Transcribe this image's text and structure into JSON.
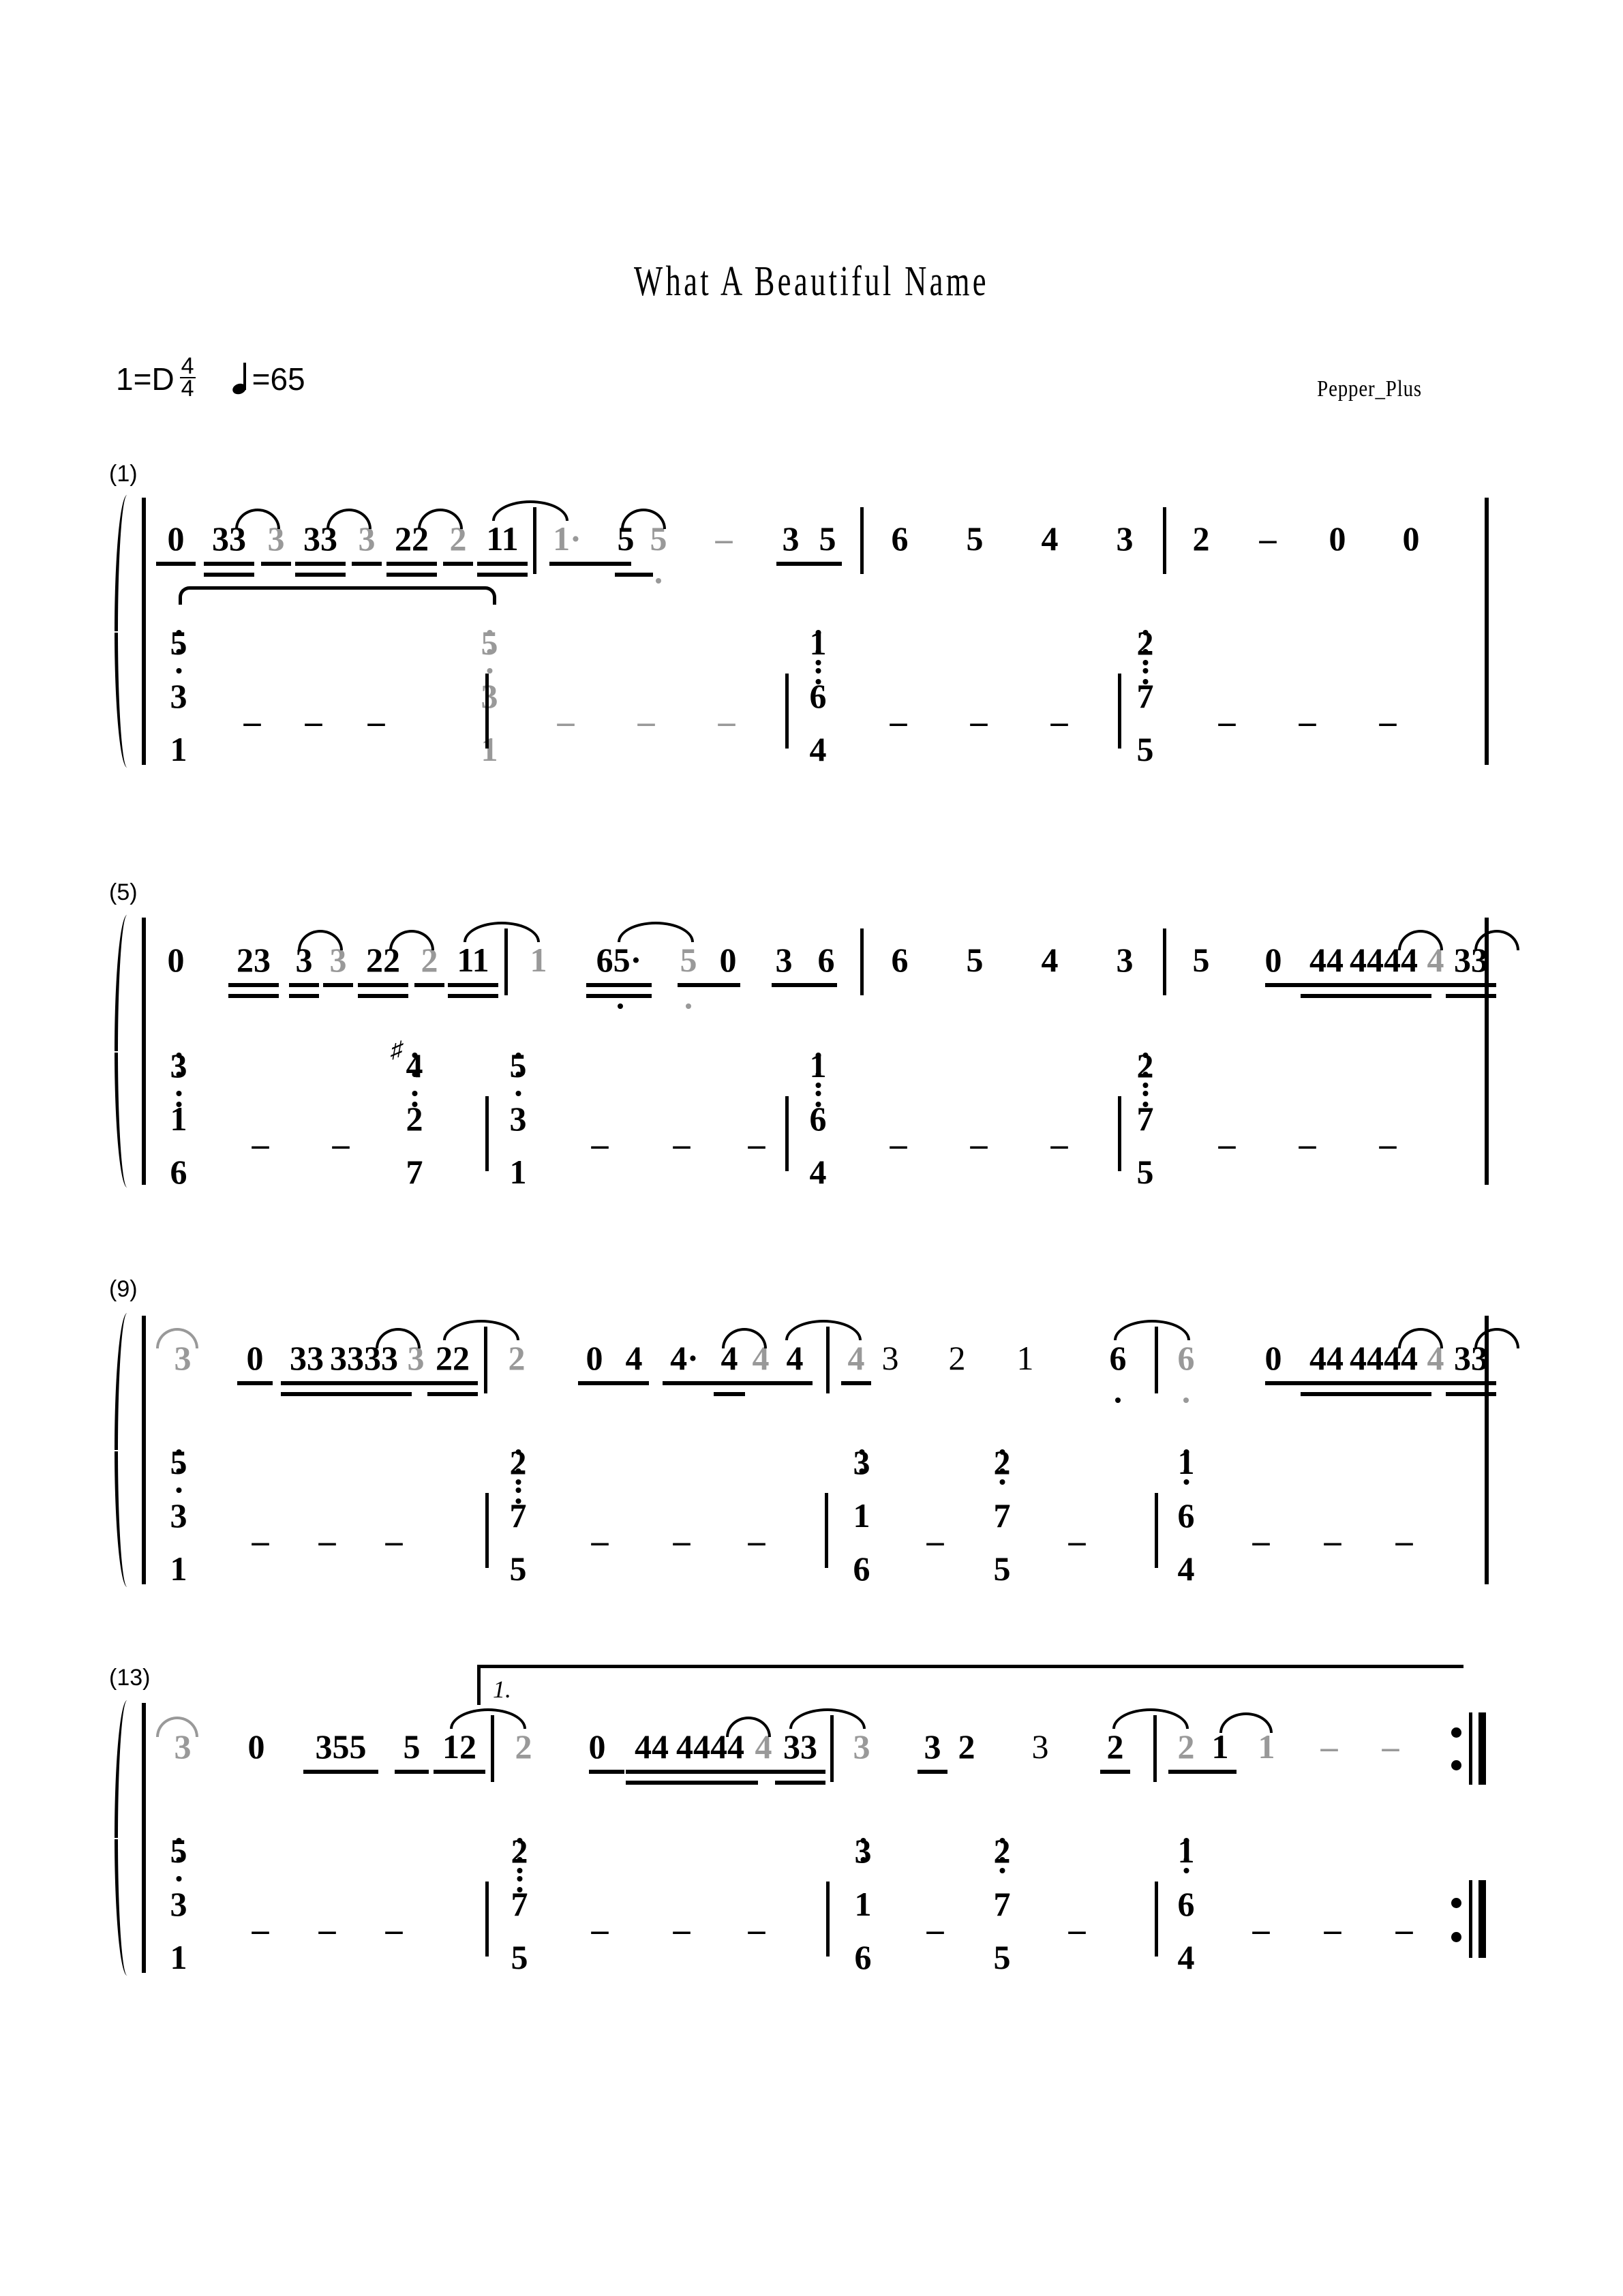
{
  "header": {
    "title": "What A Beautiful Name",
    "key_label": "1=D",
    "time_numerator": "4",
    "time_denominator": "4",
    "tempo_text": "=65",
    "tempo_note_icon": "quarter-note-icon",
    "credit": "Pepper_Plus"
  },
  "score": {
    "notation": "jianpu",
    "staves": [
      "treble",
      "bass"
    ],
    "gray_color": "#999999",
    "ink_color": "#000000",
    "systems": [
      {
        "number": "(1)",
        "treble_text": "0 33 3 33 3 22 2 11 | 1· 5 5 - 3 5 | 6 5 4 3 | 2 - 0 0 |",
        "bass_text": "5/3/1 - - - | 5/3/1 - - - | 1/6/4 - - - | 2/7/5 - - - |",
        "treble_notes": [
          "0",
          "33",
          "3",
          "33",
          "3",
          "22",
          "2",
          "11",
          "1·",
          "5",
          "5",
          "-",
          "3",
          "5",
          "6",
          "5",
          "4",
          "3",
          "2",
          "-",
          "0",
          "0"
        ],
        "bass_chords": [
          [
            "5",
            "3",
            "1"
          ],
          [
            "5",
            "3",
            "1"
          ],
          [
            "1",
            "6",
            "4"
          ],
          [
            "2",
            "7",
            "5"
          ]
        ]
      },
      {
        "number": "(5)",
        "treble_text": "0 23 3 3 22 2 11 | 1 65· 5 0 3 6 | 6 5 4 3 | 5 0 44 4444 4 33 |",
        "bass_text": "3/1/6 - - #4/2/7 | 5/3/1 - - - | 1/6/4 - - - | 2/7/5 - - - |",
        "treble_notes": [
          "0",
          "23",
          "3",
          "3",
          "22",
          "2",
          "11",
          "1",
          "65·",
          "5",
          "0",
          "3",
          "6",
          "6",
          "5",
          "4",
          "3",
          "5",
          "0",
          "44",
          "4444",
          "4",
          "33"
        ],
        "bass_chords": [
          [
            "3",
            "1",
            "6"
          ],
          [
            "#4",
            "2",
            "7"
          ],
          [
            "5",
            "3",
            "1"
          ],
          [
            "1",
            "6",
            "4"
          ],
          [
            "2",
            "7",
            "5"
          ]
        ]
      },
      {
        "number": "(9)",
        "treble_text": "3 0 33 3333 3 22 | 2 0 4 4· 4 4 4 | 4 3 2 1 6 | 6 0 44 4444 4 33 |",
        "bass_text": "5/3/1 - - - | 2/7/5 - - - | 3/1/6 - 2/7/5 - | 1/6/4 - - - |",
        "treble_notes": [
          "3",
          "0",
          "33",
          "3333",
          "3",
          "22",
          "2",
          "0",
          "4",
          "4·",
          "4",
          "4",
          "4",
          "4",
          "3",
          "2",
          "1",
          "6",
          "6",
          "0",
          "44",
          "4444",
          "4",
          "33"
        ],
        "bass_chords": [
          [
            "5",
            "3",
            "1"
          ],
          [
            "2",
            "7",
            "5"
          ],
          [
            "3",
            "1",
            "6"
          ],
          [
            "2",
            "7",
            "5"
          ],
          [
            "1",
            "6",
            "4"
          ]
        ]
      },
      {
        "number": "(13)",
        "treble_text": "3 0 355 5 12 | 2 0 44 4444 4 33 | 3 3 2 3 2 | 2 1 1 - - :||",
        "bass_text": "5/3/1 - - - | 2/7/5 - - - | 3/1/6 - 2/7/5 - | 1/6/4 - - - :||",
        "treble_notes": [
          "3",
          "0",
          "355",
          "5",
          "12",
          "2",
          "0",
          "44",
          "4444",
          "4",
          "33",
          "3",
          "3",
          "2",
          "3",
          "2",
          "2",
          "1",
          "1",
          "-",
          "-"
        ],
        "bass_chords": [
          [
            "5",
            "3",
            "1"
          ],
          [
            "2",
            "7",
            "5"
          ],
          [
            "3",
            "1",
            "6"
          ],
          [
            "2",
            "7",
            "5"
          ],
          [
            "1",
            "6",
            "4"
          ]
        ],
        "volta_label": "1.",
        "ending_sign": "repeat-end"
      }
    ]
  }
}
